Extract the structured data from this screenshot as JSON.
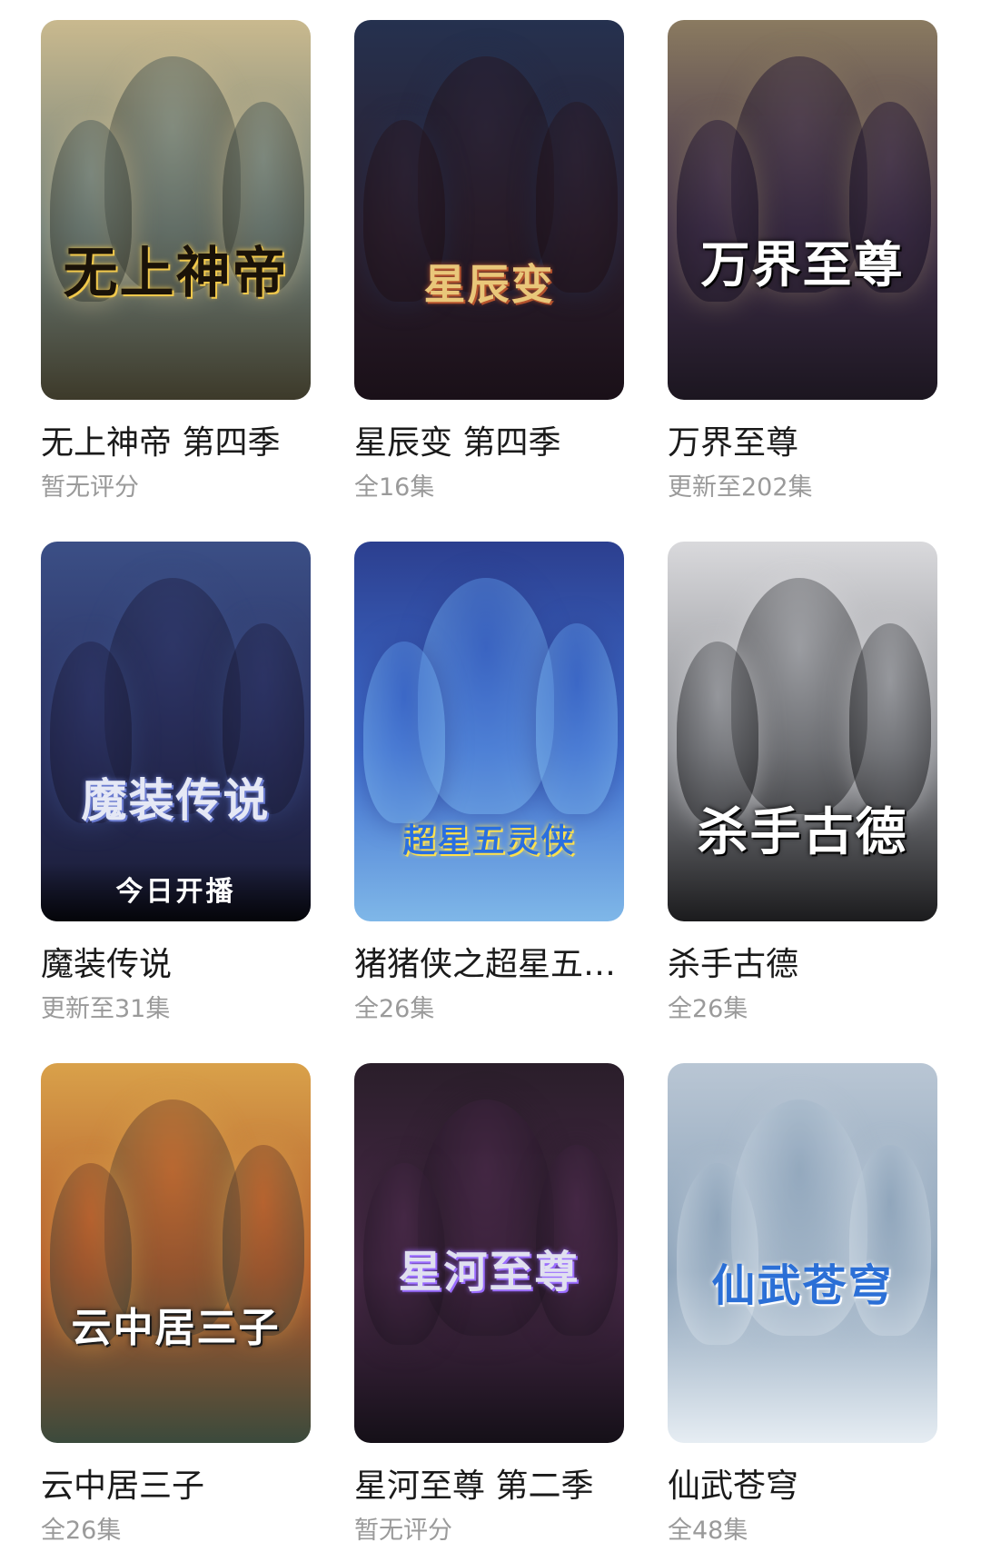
{
  "items": [
    {
      "title": "无上神帝 第四季",
      "status": "暂无评分",
      "poster_logo": "无上神帝",
      "badge": "",
      "colors": {
        "top": "#c9b98e",
        "mid": "#6f7f7a",
        "bottom": "#3d3a2a",
        "logo": "#1a1208",
        "logo_glow": "#f2c94c"
      }
    },
    {
      "title": "星辰变 第四季",
      "status": "全16集",
      "poster_logo": "星辰变",
      "badge": "",
      "colors": {
        "top": "#25314f",
        "mid": "#2c1f2e",
        "bottom": "#1a1018",
        "logo": "#e9c77a",
        "logo_glow": "#b5532e"
      }
    },
    {
      "title": "万界至尊",
      "status": "更新至202集",
      "poster_logo": "万界至尊",
      "badge": "",
      "colors": {
        "top": "#8a7a60",
        "mid": "#3f2f4a",
        "bottom": "#1c1620",
        "logo": "#ffffff",
        "logo_glow": "#000000"
      }
    },
    {
      "title": "魔装传说",
      "status": "更新至31集",
      "poster_logo": "魔装传说",
      "badge": "今日开播",
      "colors": {
        "top": "#3b4f86",
        "mid": "#2a2f5e",
        "bottom": "#191b33",
        "logo": "#e5e8f5",
        "logo_glow": "#6a7bd0"
      }
    },
    {
      "title": "猪猪侠之超星五灵侠",
      "status": "全26集",
      "poster_logo": "超星五灵侠",
      "badge": "",
      "colors": {
        "top": "#2c3f8f",
        "mid": "#3f6fd0",
        "bottom": "#7fb7e8",
        "logo": "#2a6fe0",
        "logo_glow": "#ffe14d"
      }
    },
    {
      "title": "杀手古德",
      "status": "全26集",
      "poster_logo": "杀手古德",
      "badge": "",
      "colors": {
        "top": "#d9d9dc",
        "mid": "#8a8c91",
        "bottom": "#1b1b1d",
        "logo": "#ffffff",
        "logo_glow": "#000000"
      }
    },
    {
      "title": "云中居三子",
      "status": "全26集",
      "poster_logo": "云中居三子",
      "badge": "",
      "colors": {
        "top": "#d9a14a",
        "mid": "#b0582b",
        "bottom": "#3b4a3c",
        "logo": "#ffffff",
        "logo_glow": "#1a1a1a"
      }
    },
    {
      "title": "星河至尊 第二季",
      "status": "暂无评分",
      "poster_logo": "星河至尊",
      "badge": "",
      "colors": {
        "top": "#2a1e2a",
        "mid": "#4a2a4a",
        "bottom": "#151018",
        "logo": "#e0e0f0",
        "logo_glow": "#9a6cff"
      }
    },
    {
      "title": "仙武苍穹",
      "status": "全48集",
      "poster_logo": "仙武苍穹",
      "badge": "",
      "colors": {
        "top": "#b9c6d4",
        "mid": "#8aa1b8",
        "bottom": "#e6edf3",
        "logo": "#2b6fd6",
        "logo_glow": "#ffffff"
      }
    }
  ]
}
